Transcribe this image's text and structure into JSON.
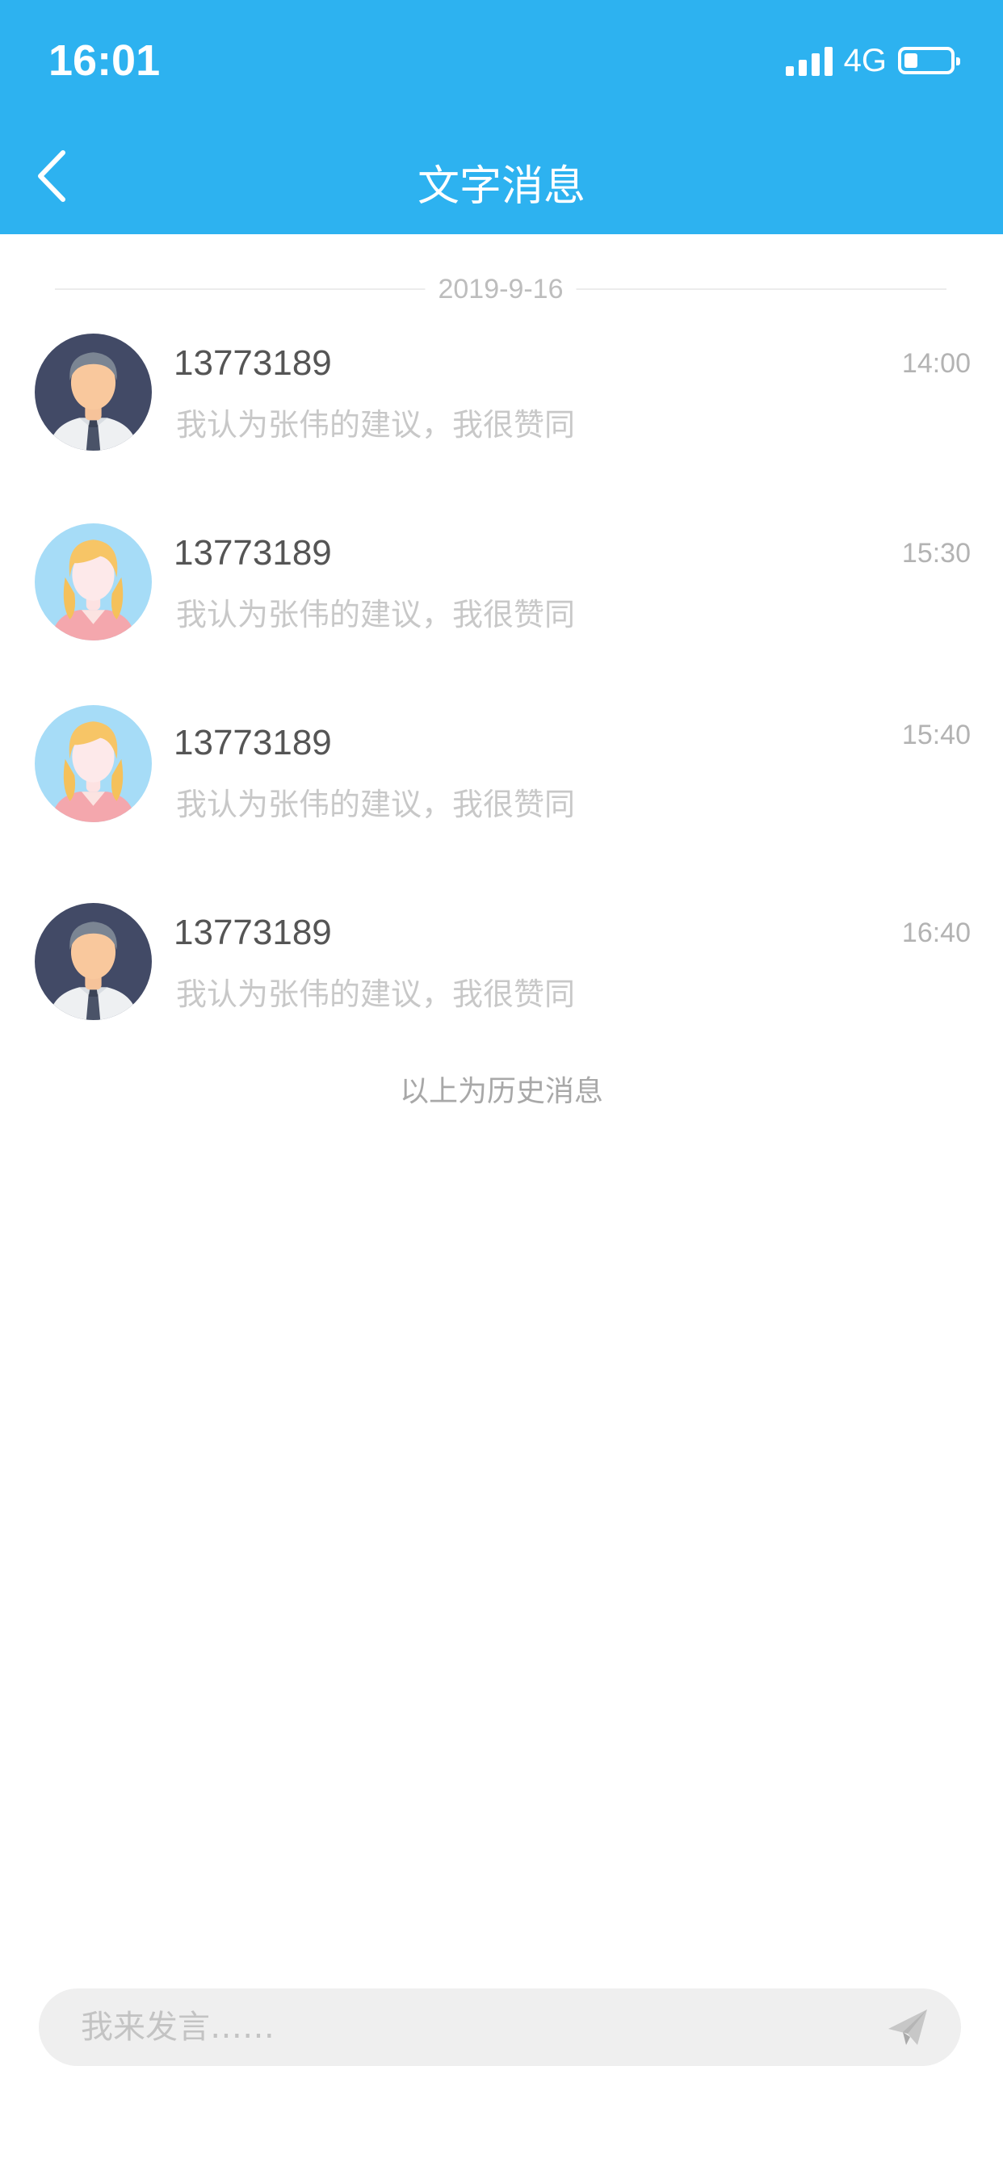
{
  "status_bar": {
    "time": "16:01",
    "network": "4G",
    "battery_level": 0.3
  },
  "header": {
    "title": "文字消息"
  },
  "date_divider": "2019-9-16",
  "messages": [
    {
      "avatar": "male-avatar",
      "sender": "13773189",
      "preview": "我认为张伟的建议，我很赞同",
      "time": "14:00"
    },
    {
      "avatar": "female-avatar",
      "sender": "13773189",
      "preview": "我认为张伟的建议，我很赞同",
      "time": "15:30"
    },
    {
      "avatar": "female-avatar",
      "sender": "13773189",
      "preview": "我认为张伟的建议，我很赞同",
      "time": "15:40"
    },
    {
      "avatar": "male-avatar",
      "sender": "13773189",
      "preview": "我认为张伟的建议，我很赞同",
      "time": "16:40"
    }
  ],
  "history_note": "以上为历史消息",
  "composer": {
    "placeholder": "我来发言……",
    "value": ""
  },
  "colors": {
    "header": "#2db2f0",
    "male_avatar_bg": "#424a66",
    "female_avatar_bg": "#a6dcf7"
  }
}
